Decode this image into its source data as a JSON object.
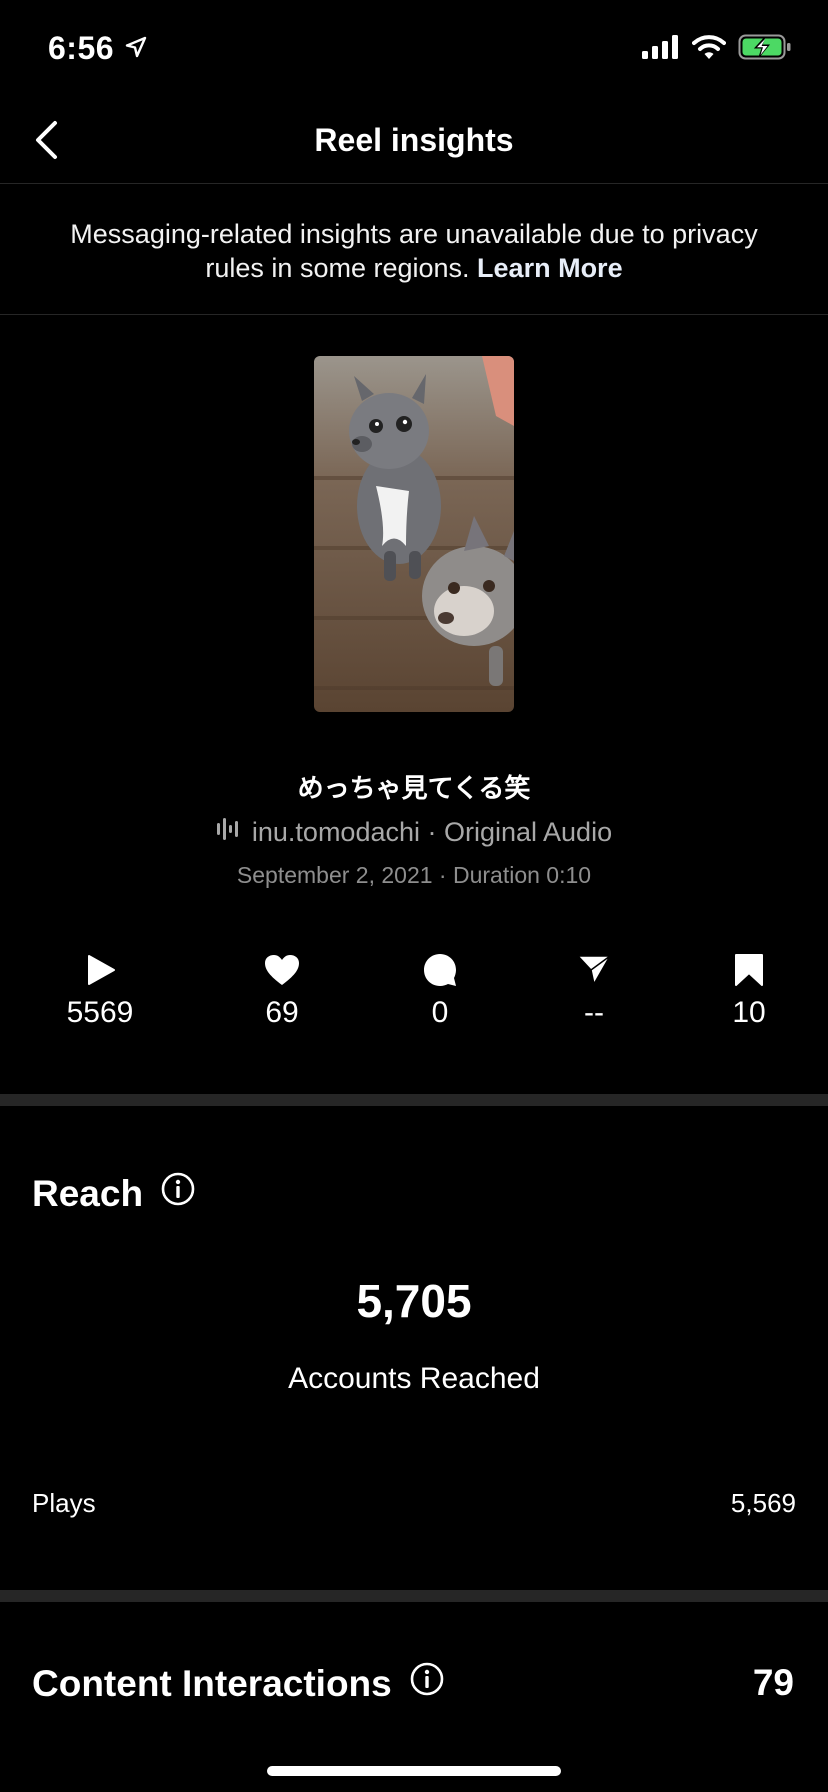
{
  "status_bar": {
    "time": "6:56",
    "battery_color": "#4cd964"
  },
  "nav": {
    "title": "Reel insights"
  },
  "notice": {
    "text": "Messaging-related insights are unavailable due to privacy rules in some regions.",
    "link": "Learn More"
  },
  "reel": {
    "caption": "めっちゃ見てくる笑",
    "audio": "inu.tomodachi · Original Audio",
    "date_duration": "September 2, 2021 · Duration 0:10"
  },
  "metrics": [
    {
      "icon": "play-icon",
      "value": "5569"
    },
    {
      "icon": "heart-icon",
      "value": "69"
    },
    {
      "icon": "comment-icon",
      "value": "0"
    },
    {
      "icon": "share-icon",
      "value": "--"
    },
    {
      "icon": "bookmark-icon",
      "value": "10"
    }
  ],
  "reach": {
    "title": "Reach",
    "number": "5,705",
    "label": "Accounts Reached",
    "plays_label": "Plays",
    "plays_value": "5,569"
  },
  "content_interactions": {
    "title": "Content Interactions",
    "value": "79"
  }
}
